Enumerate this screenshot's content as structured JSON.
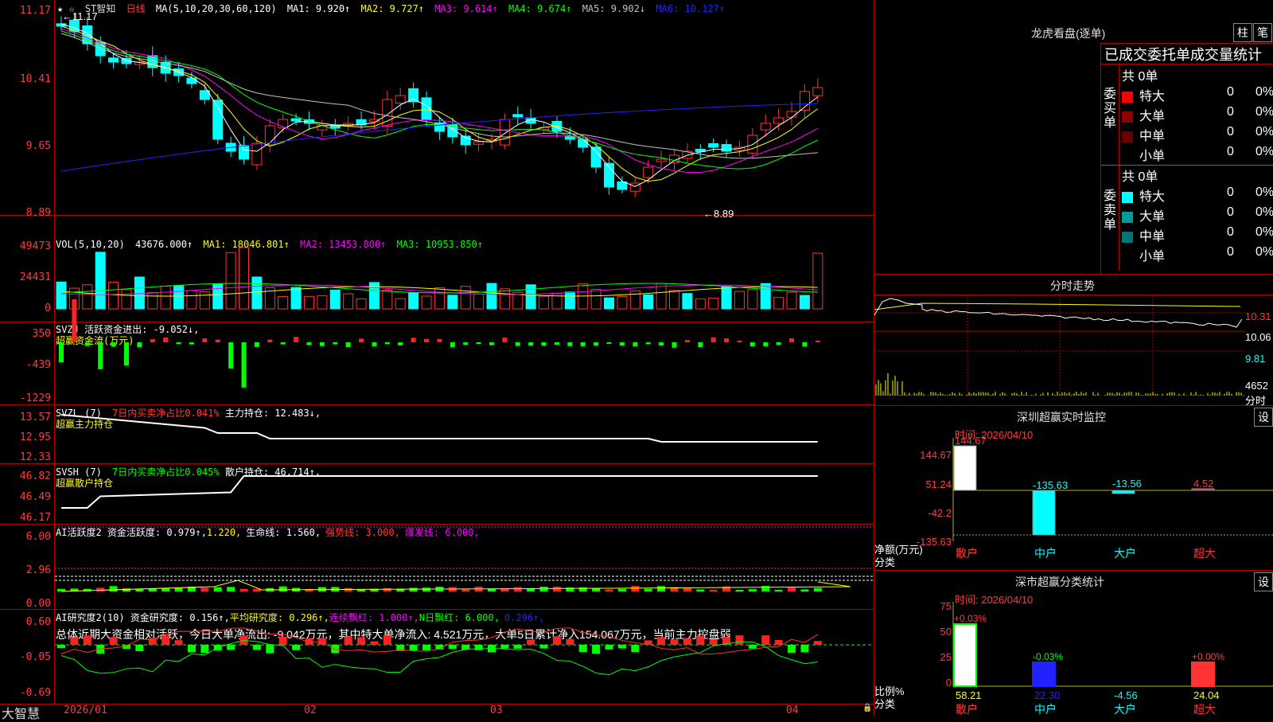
{
  "main": {
    "star_label": "★ ☆",
    "stock_name": "ST智知",
    "period": "日线",
    "ma_label": "MA(5,10,20,30,60,120)",
    "ma": [
      {
        "label": "MA1: 9.920↑",
        "color": "#ffffff"
      },
      {
        "label": "MA2: 9.727↑",
        "color": "#ffff00"
      },
      {
        "label": "MA3: 9.614↑",
        "color": "#ff00ff"
      },
      {
        "label": "MA4: 9.674↑",
        "color": "#00ff00"
      },
      {
        "label": "MA5: 9.902↓",
        "color": "#c0c0c0"
      },
      {
        "label": "MA6: 10.127↑",
        "color": "#2222ff"
      }
    ],
    "y_labels": [
      "11.17",
      "10.41",
      "9.65",
      "8.89"
    ],
    "high_marker": "11.17",
    "low_marker": "8.89"
  },
  "vol": {
    "header": "VOL(5,10,20)",
    "value": "43676.000↑",
    "ma": [
      {
        "label": "MA1: 18046.801↑",
        "color": "#ffff00"
      },
      {
        "label": "MA2: 13453.800↑",
        "color": "#ff00ff"
      },
      {
        "label": "MA3: 10953.850↑",
        "color": "#00ff00"
      }
    ],
    "y_labels": [
      "49473",
      "24431",
      "0"
    ]
  },
  "svzj": {
    "line1": "SVZJ  活跃资金进出: -9.052↓,",
    "line2": "超赢资金流(万元)",
    "y_labels": [
      "350",
      "-439",
      "-1229"
    ]
  },
  "svzl": {
    "prefix": "SVZL (7) ",
    "ratio": "7日内买卖净占比0.041%",
    "hold": " 主力持仓: 12.483↓,",
    "line2": "超赢主力持仓",
    "y_labels": [
      "13.57",
      "12.95",
      "12.33"
    ]
  },
  "svsh": {
    "prefix": "SVSH (7) ",
    "ratio": "7日内买卖净占比0.045%",
    "hold": " 散户持仓: 46.714↑,",
    "line2": "超赢散户持仓",
    "y_labels": [
      "46.82",
      "46.49",
      "46.17"
    ]
  },
  "ai1": {
    "a": "AI活跃度2 资金活跃度: 0.979↑,",
    "b": "1.220,",
    "c": "生命线: 1.560,",
    "d": "强势线: 3.000,",
    "e": "爆发线: 6.000,",
    "y_labels": [
      "6.00",
      "2.96",
      "0.00"
    ]
  },
  "ai2": {
    "a": "AI研究度2(10) 资金研究度: 0.156↑,",
    "b": "平均研究度: 0.296↑,",
    "c": "连续飘红: 1.000↑,",
    "d": "N日飘红: 6.000,",
    "e": "0.296↑,",
    "summary": "总体近期大资金相对活跃，今日大单净流出: -9.042万元，其中特大单净流入: 4.521万元，大单5日累计净入154.067万元，当前主力控盘弱",
    "y_labels": [
      "0.60",
      "-0.05",
      "-0.69"
    ]
  },
  "dates": [
    "2026/01",
    "02",
    "03",
    "04"
  ],
  "brand": "大智慧",
  "right": {
    "lhkp_title": "龙虎看盘(逐单)",
    "btn_zhu": "柱",
    "btn_bi": "笔",
    "stat_title": "已成交委托单成交量统计",
    "buy_label": "委买单",
    "sell_label": "委卖单",
    "buy_total": "共 0单",
    "sell_total": "共 0单",
    "buy_rows": [
      {
        "name": "特大",
        "val": "0",
        "pct": "0%",
        "color": "#ff0000"
      },
      {
        "name": "大单",
        "val": "0",
        "pct": "0%",
        "color": "#8b0000"
      },
      {
        "name": "中单",
        "val": "0",
        "pct": "0%",
        "color": "#700000"
      },
      {
        "name": "小单",
        "val": "0",
        "pct": "0%",
        "color": ""
      }
    ],
    "sell_rows": [
      {
        "name": "特大",
        "val": "0",
        "pct": "0%",
        "color": "#00ffff"
      },
      {
        "name": "大单",
        "val": "0",
        "pct": "0%",
        "color": "#009a9a"
      },
      {
        "name": "中单",
        "val": "0",
        "pct": "0%",
        "color": "#007777"
      },
      {
        "name": "小单",
        "val": "0",
        "pct": "0%",
        "color": ""
      }
    ],
    "fenshi_title": "分时走势",
    "fenshi_labels": [
      "10.31",
      "10.06",
      "9.81",
      "4652",
      "分时"
    ],
    "sz_title": "深圳超赢实时监控",
    "settings_btn": "设",
    "sz_time": "时间: 2026/04/10",
    "sz_y": [
      "144.67",
      "51.24",
      "-42.2",
      "-135.63"
    ],
    "sz_unit": "净额(万元)",
    "sz_unit2": "分类",
    "sz_values": [
      {
        "cat": "散户",
        "value": "144.67"
      },
      {
        "cat": "中户",
        "value": "-135.63"
      },
      {
        "cat": "大户",
        "value": "-13.56"
      },
      {
        "cat": "超大",
        "value": "4.52"
      }
    ],
    "cls_title": "深市超赢分类统计",
    "cls_time": "时间: 2026/04/10",
    "cls_y": [
      "75",
      "50",
      "25",
      "0"
    ],
    "cls_unit": "比例%",
    "cls_unit2": "分类",
    "cls_values": [
      {
        "cat": "散户",
        "pct": "+0.03%",
        "value": "58.21"
      },
      {
        "cat": "中户",
        "pct": "-0.03%",
        "value": "22.30"
      },
      {
        "cat": "大户",
        "pct": "",
        "value": "-4.56"
      },
      {
        "cat": "超大",
        "pct": "+0.00%",
        "value": "24.04"
      }
    ]
  }
}
